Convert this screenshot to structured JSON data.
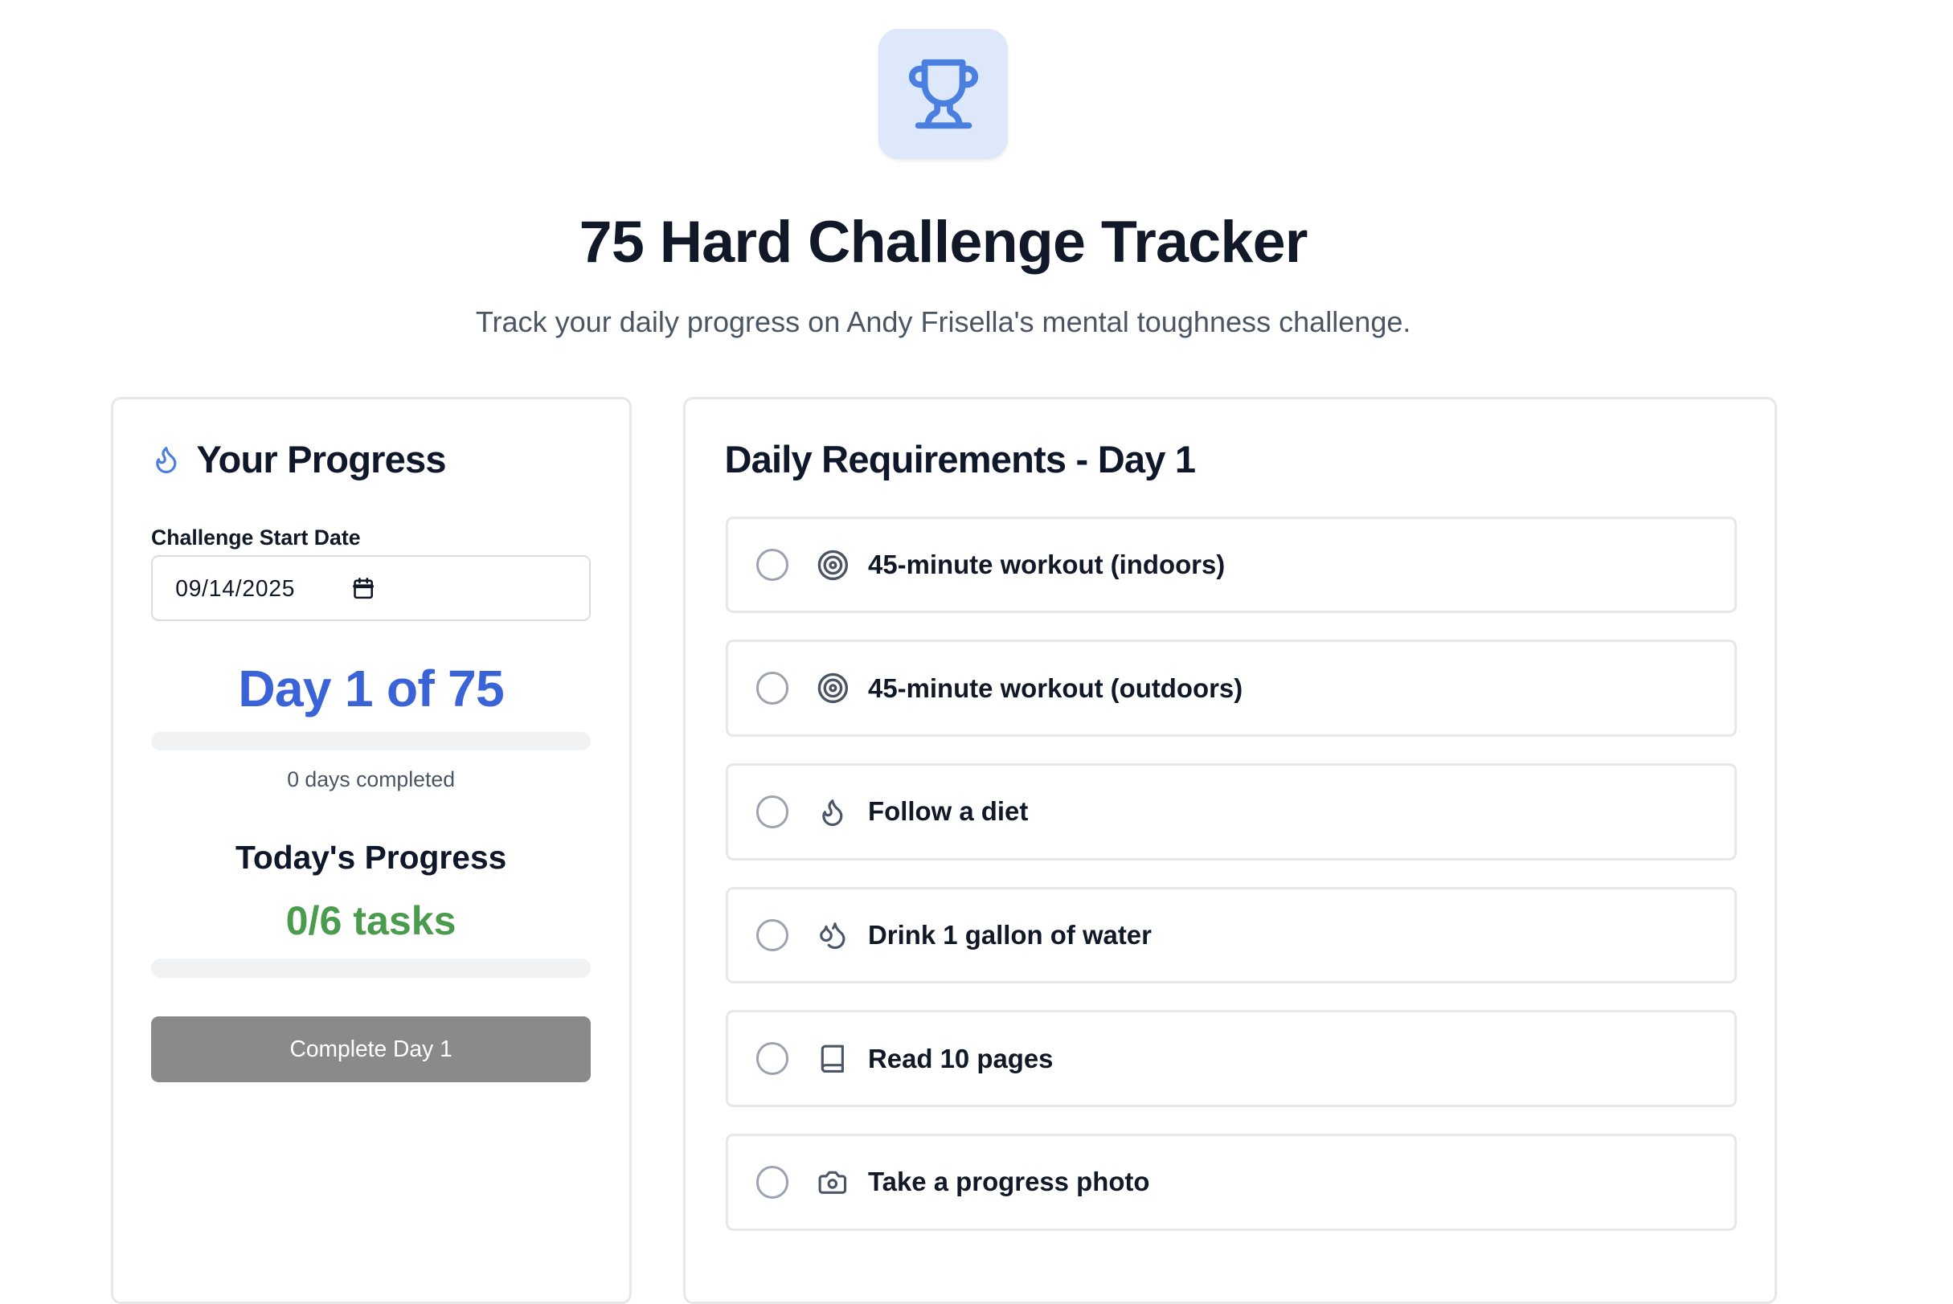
{
  "header": {
    "title": "75 Hard Challenge Tracker",
    "subtitle": "Track your daily progress on Andy Frisella's mental toughness challenge.",
    "icon": "trophy-icon"
  },
  "progress": {
    "heading": "Your Progress",
    "heading_icon": "flame-icon",
    "start_date_label": "Challenge Start Date",
    "start_date_value": "09/14/2025",
    "day_label": "Day 1 of 75",
    "challenge_progress_fraction": 0,
    "days_completed": "0 days completed",
    "today_heading": "Today's Progress",
    "tasks_count": "0/6 tasks",
    "today_progress_fraction": 0,
    "complete_button": "Complete Day 1"
  },
  "requirements": {
    "heading": "Daily Requirements - Day 1",
    "items": [
      {
        "label": "45-minute workout (indoors)",
        "icon": "target-icon",
        "checked": false
      },
      {
        "label": "45-minute workout (outdoors)",
        "icon": "target-icon",
        "checked": false
      },
      {
        "label": "Follow a diet",
        "icon": "flame-icon",
        "checked": false
      },
      {
        "label": "Drink 1 gallon of water",
        "icon": "droplets-icon",
        "checked": false
      },
      {
        "label": "Read 10 pages",
        "icon": "book-icon",
        "checked": false
      },
      {
        "label": "Take a progress photo",
        "icon": "camera-icon",
        "checked": false
      }
    ]
  },
  "colors": {
    "accent_blue": "#3b63d8",
    "success_green": "#4a9b4e",
    "disabled_button": "#8a8a8a",
    "icon_tile": "#dde8fb"
  }
}
